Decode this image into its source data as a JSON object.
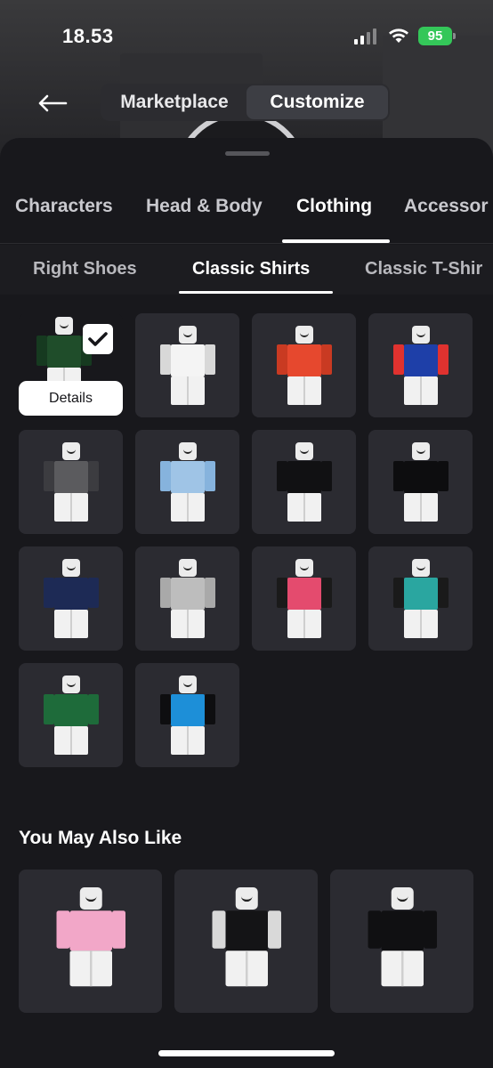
{
  "status_bar": {
    "time": "18.53",
    "battery": "95"
  },
  "header": {
    "segments": [
      "Marketplace",
      "Customize"
    ],
    "active_segment": "Customize"
  },
  "tabs": [
    "Characters",
    "Head & Body",
    "Clothing",
    "Accessor"
  ],
  "active_tab": "Clothing",
  "subtabs": [
    "Right Shoes",
    "Classic Shirts",
    "Classic T-Shir"
  ],
  "active_subtab": "Classic Shirts",
  "grid": {
    "details_label": "Details",
    "items": [
      {
        "name": "green-black-shirt",
        "torso": "#1f4d2a",
        "arms": "#163a20",
        "selected": true
      },
      {
        "name": "white-floral-shirt",
        "torso": "#f4f4f4",
        "arms": "#d8d8d8"
      },
      {
        "name": "orange-jersey-shirt",
        "torso": "#e6482e",
        "arms": "#c93a22"
      },
      {
        "name": "blue-red-yellow-shirt",
        "torso": "#1e3fa8",
        "arms": "#e0322f"
      },
      {
        "name": "grey-vest-shirt",
        "torso": "#5b5b5e",
        "arms": "#3c3c40"
      },
      {
        "name": "denim-jacket-shirt",
        "torso": "#9fc4e6",
        "arms": "#86b3dd"
      },
      {
        "name": "black-tee-shirt-1",
        "torso": "#111113",
        "arms": "#111113"
      },
      {
        "name": "black-tee-shirt-2",
        "torso": "#0d0d0f",
        "arms": "#0d0d0f"
      },
      {
        "name": "navy-graphic-shirt",
        "torso": "#1d2a55",
        "arms": "#1d2a55"
      },
      {
        "name": "grey-green-graphic-shirt",
        "torso": "#bdbdbd",
        "arms": "#a9a9a9"
      },
      {
        "name": "rainbow-jacket-shirt",
        "torso": "#e44b6e",
        "arms": "#1a1a1a"
      },
      {
        "name": "teal-leather-jacket-shirt",
        "torso": "#2aa6a0",
        "arms": "#1a1a1a"
      },
      {
        "name": "green-varsity-shirt",
        "torso": "#1e6b3a",
        "arms": "#1e6b3a"
      },
      {
        "name": "black-blue-jacket-shirt",
        "torso": "#1d8fd8",
        "arms": "#0e0e10"
      }
    ]
  },
  "you_may_also_like": {
    "title": "You May Also Like",
    "items": [
      {
        "name": "pink-hello-kitty-shirt",
        "torso": "#f2a7c8",
        "arms": "#f2a7c8"
      },
      {
        "name": "black-g30-shirt",
        "torso": "#141416",
        "arms": "#d9d9d9"
      },
      {
        "name": "black-graffiti-shirt",
        "torso": "#101012",
        "arms": "#101012"
      }
    ]
  }
}
